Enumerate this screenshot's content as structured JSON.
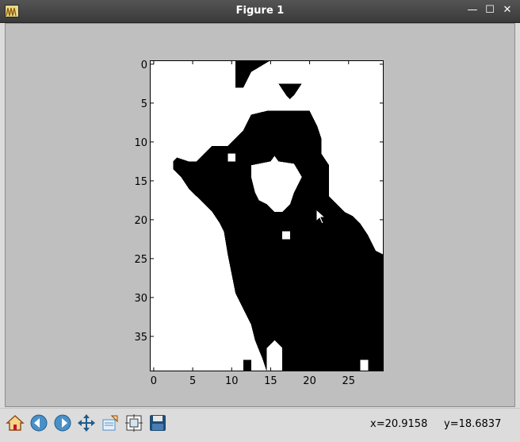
{
  "window": {
    "title": "Figure 1",
    "minimize_glyph": "—",
    "maximize_glyph": "☐",
    "close_glyph": "✕"
  },
  "figure": {
    "xaxis_ticks": [
      "0",
      "5",
      "10",
      "15",
      "20",
      "25"
    ],
    "yaxis_ticks": [
      "0",
      "5",
      "10",
      "15",
      "20",
      "25",
      "30",
      "35"
    ]
  },
  "image_data": {
    "type": "binary image",
    "columns": 30,
    "rows": 40,
    "foreground": "#000000",
    "background": "#ffffff"
  },
  "toolbar": {
    "buttons": [
      {
        "icon": "home-icon"
      },
      {
        "icon": "back-icon"
      },
      {
        "icon": "forward-icon"
      },
      {
        "icon": "pan-icon"
      },
      {
        "icon": "zoom-icon"
      },
      {
        "icon": "configure-subplots-icon"
      },
      {
        "icon": "save-icon"
      }
    ]
  },
  "status": {
    "x_readout": "x=20.9158",
    "y_readout": "y=18.6837"
  }
}
